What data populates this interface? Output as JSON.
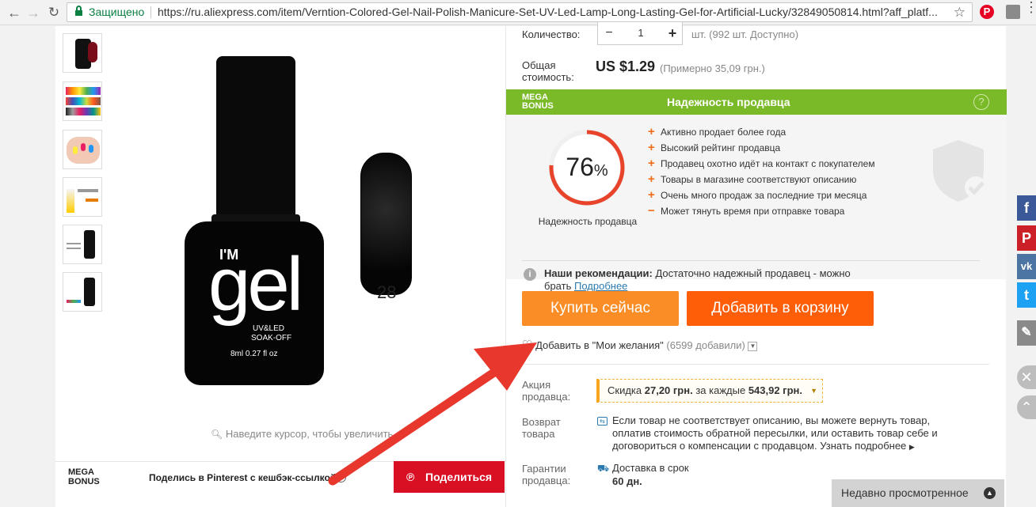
{
  "browser": {
    "secure_label": "Защищено",
    "url": "https://ru.aliexpress.com/item/Verntion-Colored-Gel-Nail-Polish-Manicure-Set-UV-Led-Lamp-Long-Lasting-Gel-for-Artificial-Lucky/32849050814.html?aff_platf...",
    "back_icon": "back-arrow-icon",
    "forward_icon": "forward-arrow-icon",
    "reload_icon": "reload-icon",
    "star_icon": "star-icon",
    "extensions": [
      "pinterest-icon",
      "feedly-icon",
      "menu-icon"
    ]
  },
  "gallery": {
    "bottle_text_1": "I'M",
    "bottle_text_2": "gel",
    "bottle_text_3": "UV&LED",
    "bottle_text_4": "SOAK-OFF",
    "bottle_text_5": "8ml 0.27 fl oz",
    "color_number": "28",
    "zoom_hint": "Наведите курсор, чтобы увеличить"
  },
  "megabonus_bar": {
    "logo_line1": "MEGA",
    "logo_line2": "BONUS",
    "text": "Поделись в Pinterest с кешбэк-ссылкой",
    "share_button": "Поделиться"
  },
  "order": {
    "quantity_label": "Количество:",
    "quantity_value": "1",
    "minus": "−",
    "plus": "+",
    "stock": "шт. (992 шт. Доступно)",
    "total_label_1": "Общая",
    "total_label_2": "стоимость:",
    "price": "US $1.29",
    "price_approx": "(Примерно 35,09 грн.)"
  },
  "seller_reliability": {
    "logo_line1": "MEGA",
    "logo_line2": "BONUS",
    "title": "Надежность продавца",
    "help_icon": "?",
    "score": "76",
    "score_unit": "%",
    "score_fraction": 0.76,
    "score_caption": "Надежность продавца",
    "items": [
      {
        "mark": "+",
        "text": "Активно продает более года"
      },
      {
        "mark": "+",
        "text": "Высокий рейтинг продавца"
      },
      {
        "mark": "+",
        "text": "Продавец охотно идёт на контакт с покупателем"
      },
      {
        "mark": "+",
        "text": "Товары в магазине соответствуют описанию"
      },
      {
        "mark": "+",
        "text": "Очень много продаж за последние три месяца"
      },
      {
        "mark": "−",
        "text": "Может тянуть время при отправке товара"
      }
    ],
    "recommendation_bold": "Наши рекомендации:",
    "recommendation_text": " Достаточно надежный продавец - можно",
    "recommendation_text2": "брать",
    "more_link": "Подробнее"
  },
  "actions": {
    "buy_now": "Купить сейчас",
    "add_to_cart": "Добавить в корзину",
    "wishlist": "Добавить в \"Мои желания\"",
    "wishlist_count": "(6599 добавили)"
  },
  "details": {
    "promo_label_1": "Акция",
    "promo_label_2": "продавца:",
    "promo_prefix": "Скидка ",
    "promo_amount": "27,20 грн.",
    "promo_mid": " за каждые ",
    "promo_threshold": "543,92 грн.",
    "return_label_1": "Возврат",
    "return_label_2": "товара",
    "return_line1": "Если товар не соответствует описанию, вы можете вернуть товар,",
    "return_line2": "оплатив стоимость обратной пересылки, или оставить товар себе и",
    "return_line3": "договориться о компенсации с продавцом.",
    "return_link": "Узнать подробнее",
    "guarantee_label_1": "Гарантии",
    "guarantee_label_2": "продавца:",
    "delivery_label": "Доставка в срок",
    "delivery_days": "60 дн."
  },
  "recently_viewed": "Недавно просмотренное",
  "social": {
    "facebook": "f",
    "pinterest": "P",
    "vk": "vk",
    "twitter": "t"
  },
  "colors": {
    "mega_green": "#7ab928",
    "buy_orange": "#fa8d26",
    "cart_orange": "#fd5e07",
    "share_red": "#d90f24",
    "arrow_red": "#e8372c"
  }
}
